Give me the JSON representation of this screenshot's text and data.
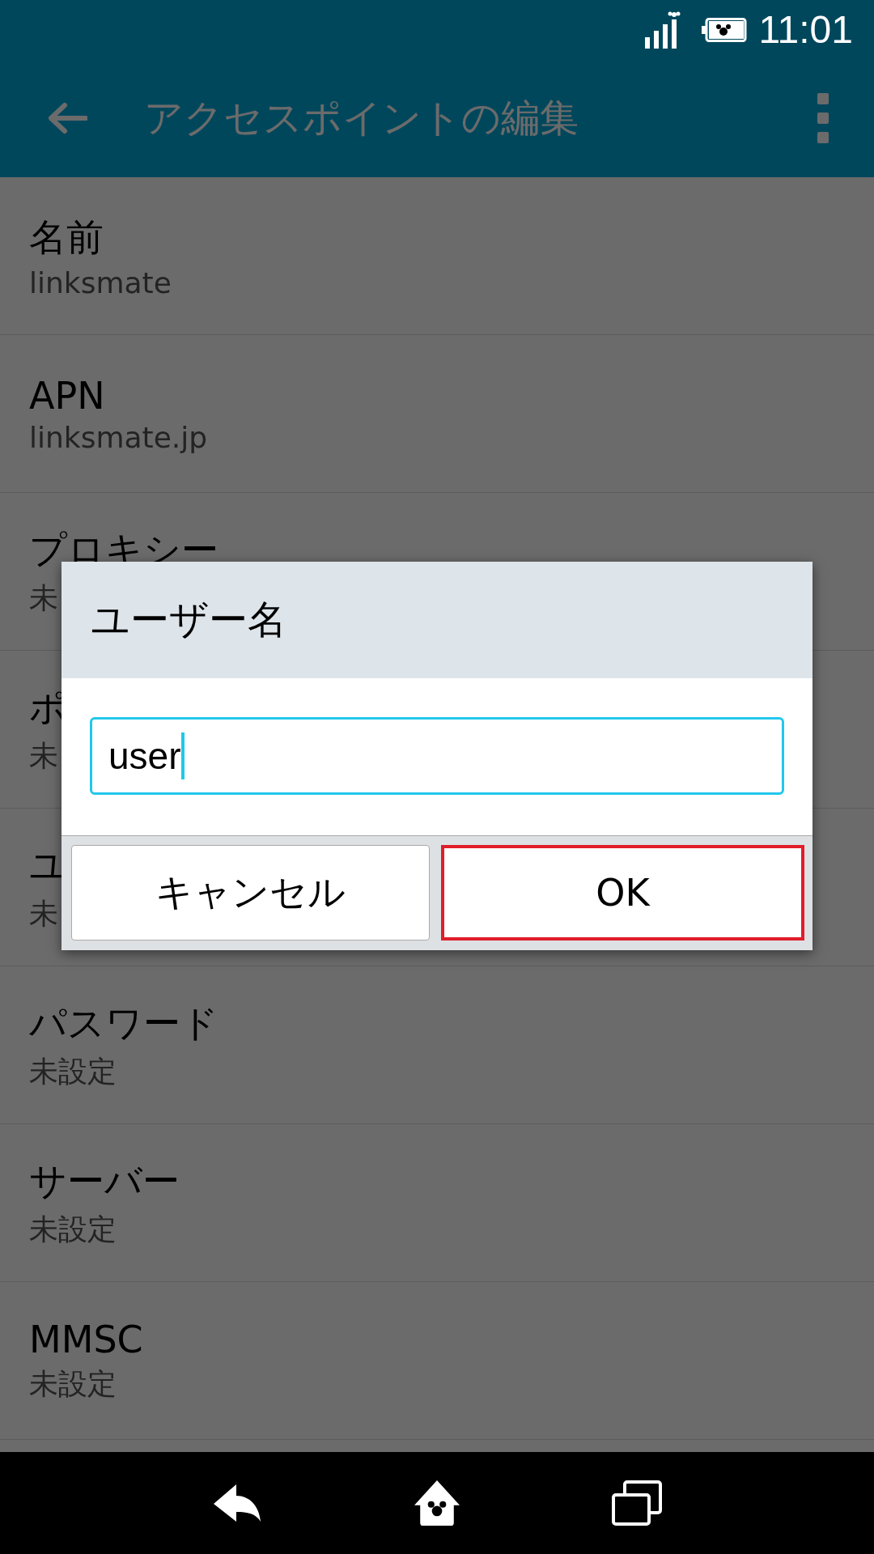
{
  "status_bar": {
    "time": "11:01"
  },
  "app_bar": {
    "title": "アクセスポイントの編集"
  },
  "settings": [
    {
      "title": "名前",
      "value": "linksmate"
    },
    {
      "title": "APN",
      "value": "linksmate.jp"
    },
    {
      "title": "プロキシー",
      "value": "未"
    },
    {
      "title": "ポ",
      "value": "未"
    },
    {
      "title": "ユ",
      "value": "未"
    },
    {
      "title": "パスワード",
      "value": "未設定"
    },
    {
      "title": "サーバー",
      "value": "未設定"
    },
    {
      "title": "MMSC",
      "value": "未設定"
    }
  ],
  "dialog": {
    "title": "ユーザー名",
    "input": {
      "value": "user",
      "focused": true
    },
    "buttons": [
      {
        "label": "キャンセル",
        "focused": false
      },
      {
        "label": "OK",
        "focused": true
      }
    ]
  }
}
